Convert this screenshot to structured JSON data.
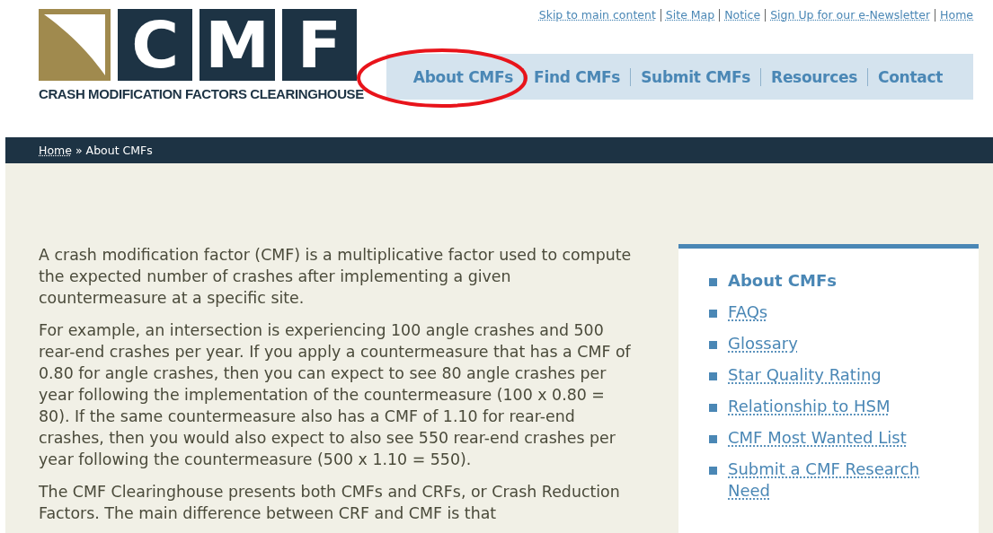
{
  "logo": {
    "letters": [
      "C",
      "M",
      "F"
    ],
    "tagline": "CRASH MODIFICATION FACTORS CLEARINGHOUSE"
  },
  "utility_links": [
    "Skip to main content",
    "Site Map",
    "Notice",
    "Sign Up for our e-Newsletter",
    "Home"
  ],
  "nav": [
    "About CMFs",
    "Find CMFs",
    "Submit CMFs",
    "Resources",
    "Contact"
  ],
  "breadcrumb": {
    "home": "Home",
    "separator": "»",
    "current": "About CMFs"
  },
  "paragraphs": [
    "A crash modification factor (CMF) is a multiplicative factor used to compute the expected number of crashes after implementing a given countermeasure at a specific site.",
    "For example, an intersection is experiencing 100 angle crashes and 500 rear-end crashes per year. If you apply a countermeasure that has a CMF of 0.80 for angle crashes, then you can expect to see 80 angle crashes per year following the implementation of the countermeasure (100 x 0.80 = 80). If the same countermeasure also has a CMF of 1.10 for rear-end crashes, then you would also expect to also see 550 rear-end crashes per year following the countermeasure (500 x 1.10 = 550).",
    "The CMF Clearinghouse presents both CMFs and CRFs, or Crash Reduction Factors. The main difference between CRF and CMF is that"
  ],
  "sidebar": [
    {
      "label": "About CMFs",
      "selected": true
    },
    {
      "label": "FAQs",
      "selected": false
    },
    {
      "label": "Glossary",
      "selected": false
    },
    {
      "label": "Star Quality Rating",
      "selected": false
    },
    {
      "label": "Relationship to HSM",
      "selected": false
    },
    {
      "label": "CMF Most Wanted List",
      "selected": false
    },
    {
      "label": "Submit a CMF Research Need",
      "selected": false
    }
  ]
}
